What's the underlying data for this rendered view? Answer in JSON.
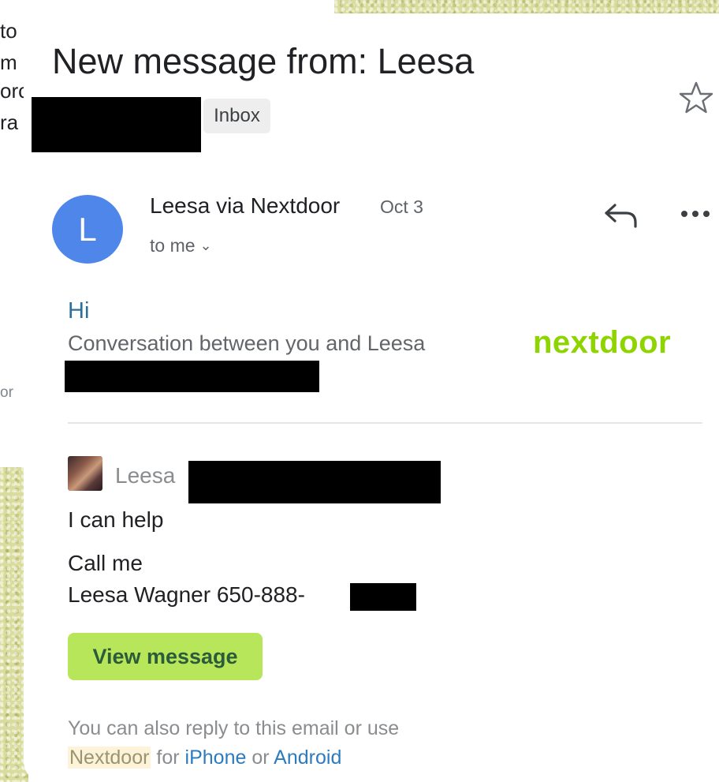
{
  "behind": {
    "line1": "to",
    "line2": "m i",
    "line3": "orc",
    "line4": "ra",
    "line5": "or"
  },
  "email": {
    "subject": "New message from: Leesa",
    "label": "Inbox"
  },
  "sender": {
    "avatar_letter": "L",
    "name": "Leesa via Nextdoor",
    "date": "Oct 3",
    "recipient": "to me"
  },
  "body": {
    "greeting": "Hi",
    "conversation": "Conversation between you and Leesa",
    "logo": "nextdoor",
    "message_author": "Leesa",
    "line1": "I can help",
    "line2": "Call me",
    "line3": "Leesa Wagner 650-888-",
    "button": "View message",
    "footer_line1": "You can also reply to this email or use",
    "footer_app": "Nextdoor",
    "footer_for": "for",
    "footer_iphone": "iPhone",
    "footer_or": "or",
    "footer_android": "Android"
  },
  "colors": {
    "avatar": "#4f86e9",
    "brand_green": "#8ed500",
    "button_bg": "#b8e65a",
    "link": "#2d7bbf"
  }
}
